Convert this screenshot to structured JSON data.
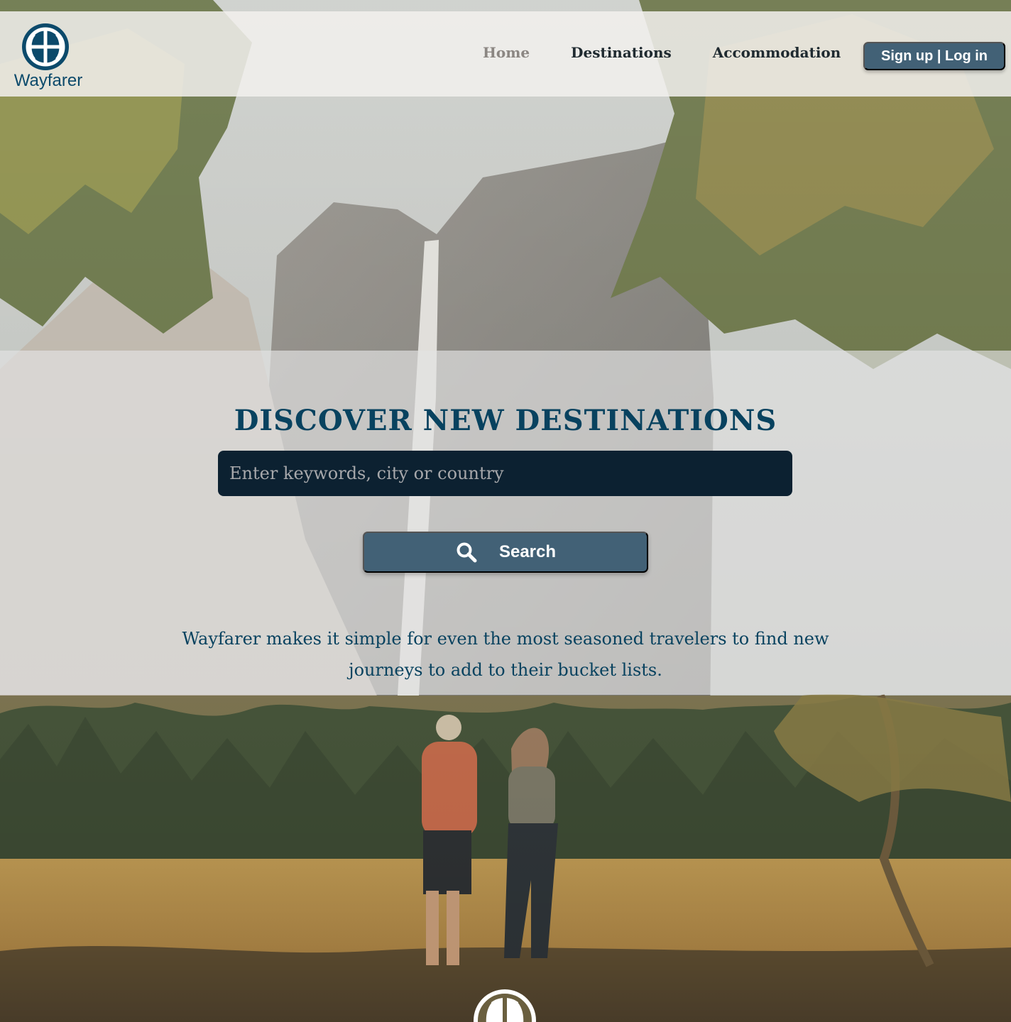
{
  "header": {
    "logo_text": "Wayfarer",
    "nav": [
      {
        "label": "Home",
        "active": true
      },
      {
        "label": "Destinations",
        "active": false
      },
      {
        "label": "Accommodation",
        "active": false
      }
    ],
    "auth_label": "Sign up | Log in"
  },
  "hero": {
    "title": "DISCOVER NEW DESTINATIONS",
    "search": {
      "placeholder": "Enter keywords, city or country",
      "value": "",
      "button_label": "Search",
      "icon": "search-icon"
    },
    "description": "Wayfarer makes it simple for even the most seasoned travelers to find new journeys to add to their bucket lists."
  },
  "colors": {
    "brand_blue": "#08425f",
    "button_blue": "#426176",
    "input_dark": "#0c2131"
  },
  "icons": {
    "logo": "globe-logo-icon",
    "footer_logo": "globe-logo-icon"
  }
}
